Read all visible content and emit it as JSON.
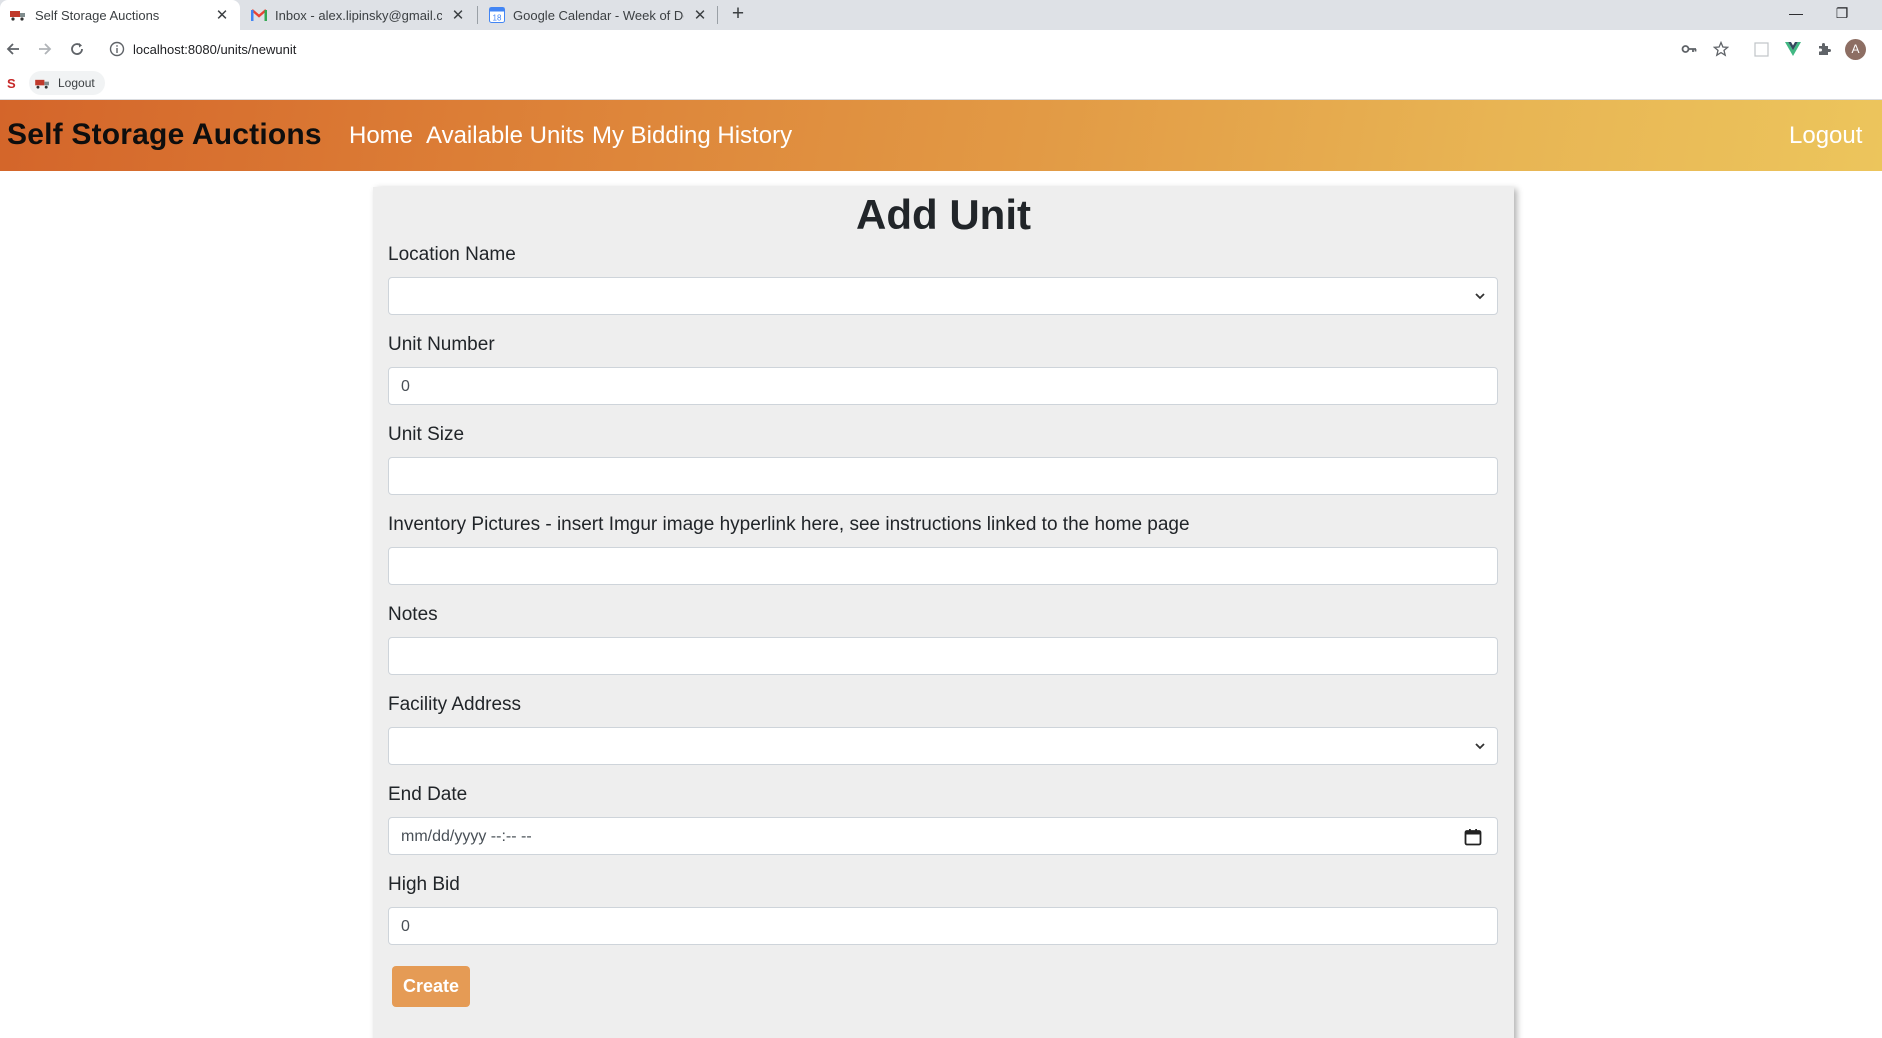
{
  "browser": {
    "tabs": [
      {
        "title": "Self Storage Auctions",
        "active": true,
        "icon": "truck-icon"
      },
      {
        "title": "Inbox - alex.lipinsky@gmail.com",
        "active": false,
        "icon": "gmail-icon"
      },
      {
        "title": "Google Calendar - Week of Dece",
        "active": false,
        "icon": "calendar-icon"
      }
    ],
    "calendar_icon_text": "18",
    "url": "localhost:8080/units/newunit",
    "avatar_letter": "A",
    "bookmarks": [
      {
        "label": "Logout",
        "icon": "truck-icon"
      }
    ]
  },
  "nav": {
    "brand": "Self Storage Auctions",
    "links": [
      "Home",
      "Available Units",
      "My Bidding History"
    ],
    "logout": "Logout",
    "gradient_colors": [
      "#d4652a",
      "#ecc55c"
    ]
  },
  "form": {
    "title": "Add Unit",
    "fields": [
      {
        "label": "Location Name",
        "type": "select",
        "value": ""
      },
      {
        "label": "Unit Number",
        "type": "number",
        "value": "0"
      },
      {
        "label": "Unit Size",
        "type": "text",
        "value": ""
      },
      {
        "label": "Inventory Pictures - insert Imgur image hyperlink here, see instructions linked to the home page",
        "type": "text",
        "value": ""
      },
      {
        "label": "Notes",
        "type": "text",
        "value": ""
      },
      {
        "label": "Facility Address",
        "type": "select",
        "value": ""
      },
      {
        "label": "End Date",
        "type": "datetime-local",
        "value": "",
        "placeholder": "mm/dd/yyyy --:-- --"
      },
      {
        "label": "High Bid",
        "type": "number",
        "value": "0"
      }
    ],
    "submit_label": "Create",
    "accent": "#e59b55"
  }
}
